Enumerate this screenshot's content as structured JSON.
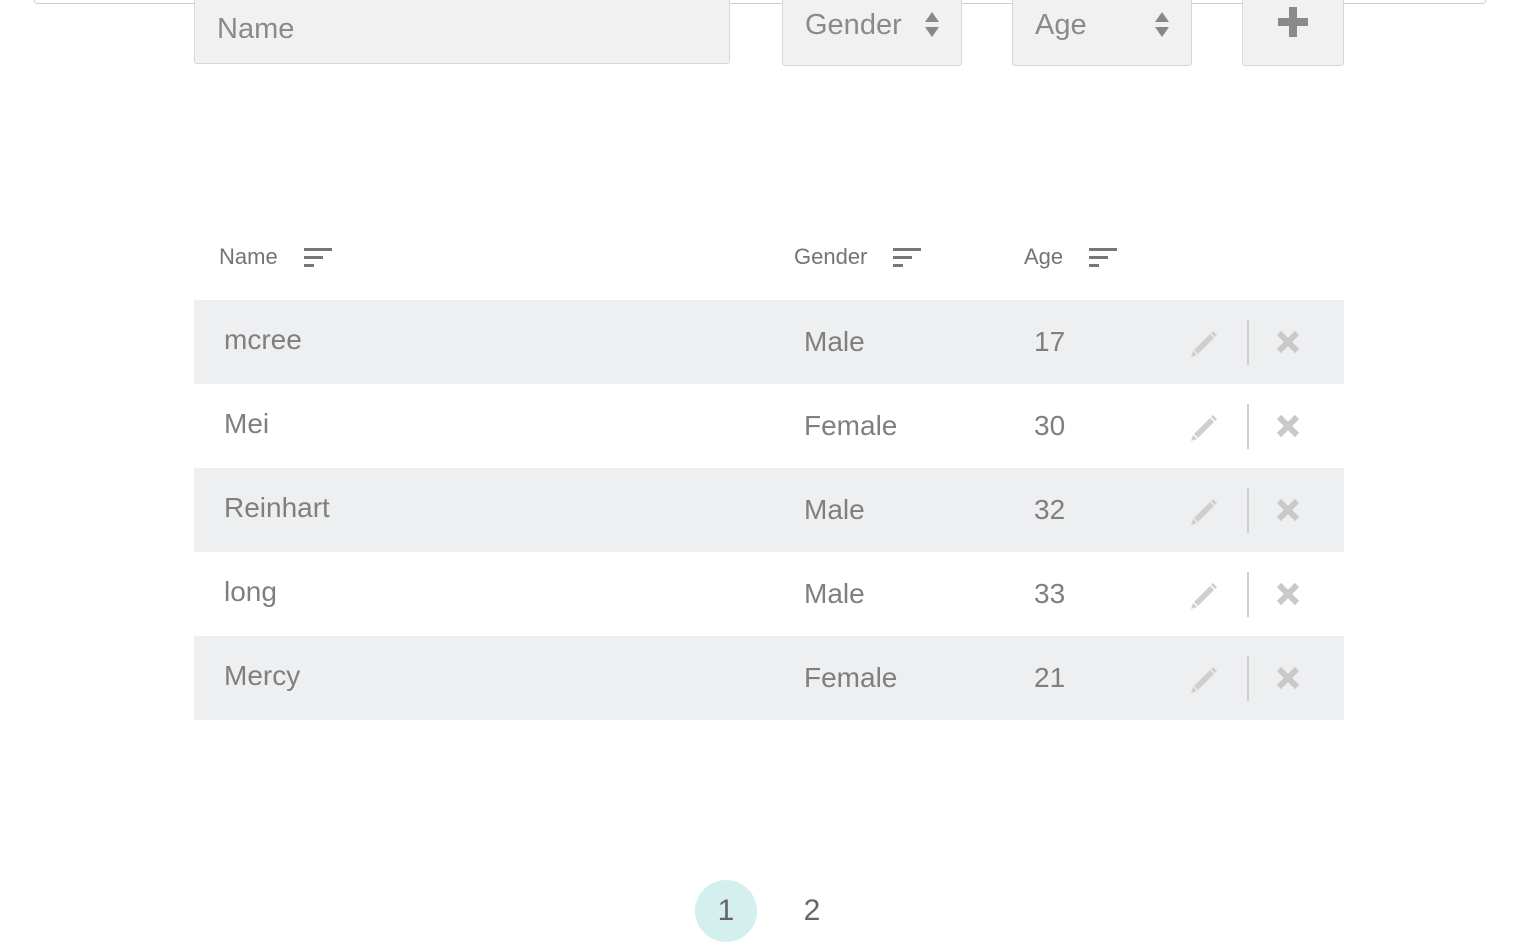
{
  "form": {
    "name_placeholder": "Name",
    "gender_label": "Gender",
    "age_label": "Age",
    "add_icon": "plus-icon"
  },
  "table": {
    "headers": {
      "name": "Name",
      "gender": "Gender",
      "age": "Age"
    },
    "rows": [
      {
        "name": "mcree",
        "gender": "Male",
        "age": "17"
      },
      {
        "name": "Mei",
        "gender": "Female",
        "age": "30"
      },
      {
        "name": "Reinhart",
        "gender": "Male",
        "age": "32"
      },
      {
        "name": "long",
        "gender": "Male",
        "age": "33"
      },
      {
        "name": "Mercy",
        "gender": "Female",
        "age": "21"
      }
    ]
  },
  "pagination": {
    "pages": [
      "1",
      "2"
    ],
    "active": "1"
  },
  "colors": {
    "row_shade": "#eeeff0",
    "active_page": "#d3f0ef",
    "text": "#7f7f7f",
    "icon": "#c9c9c9"
  }
}
